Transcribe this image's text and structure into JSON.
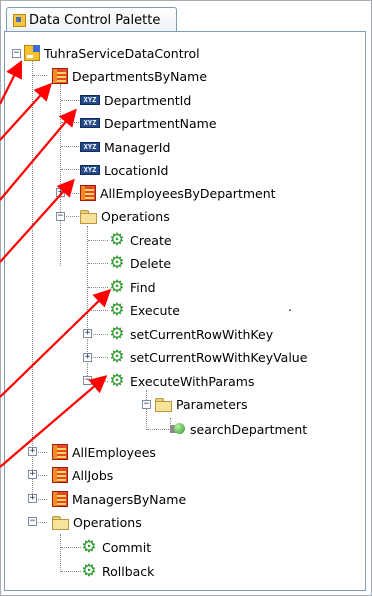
{
  "palette": {
    "tab_title": "Data Control Palette"
  },
  "tree": {
    "root": "TuhraServiceDataControl",
    "departments_by_name": "DepartmentsByName",
    "attr_icon_text": "XYZ",
    "attributes": [
      "DepartmentId",
      "DepartmentName",
      "ManagerId",
      "LocationId"
    ],
    "all_employees_by_department": "AllEmployeesByDepartment",
    "operations_label": "Operations",
    "operations": [
      "Create",
      "Delete",
      "Find",
      "Execute",
      "setCurrentRowWithKey",
      "setCurrentRowWithKeyValue",
      "ExecuteWithParams"
    ],
    "parameters_label": "Parameters",
    "parameter": "searchDepartment",
    "collections": [
      "AllEmployees",
      "AllJobs",
      "ManagersByName"
    ],
    "root_operations_label": "Operations",
    "root_operations": [
      "Commit",
      "Rollback"
    ],
    "dot": "."
  },
  "colors": {
    "arrow": "#ff0000",
    "gear": "#2d9a2d",
    "collection": "#e44a2a"
  }
}
